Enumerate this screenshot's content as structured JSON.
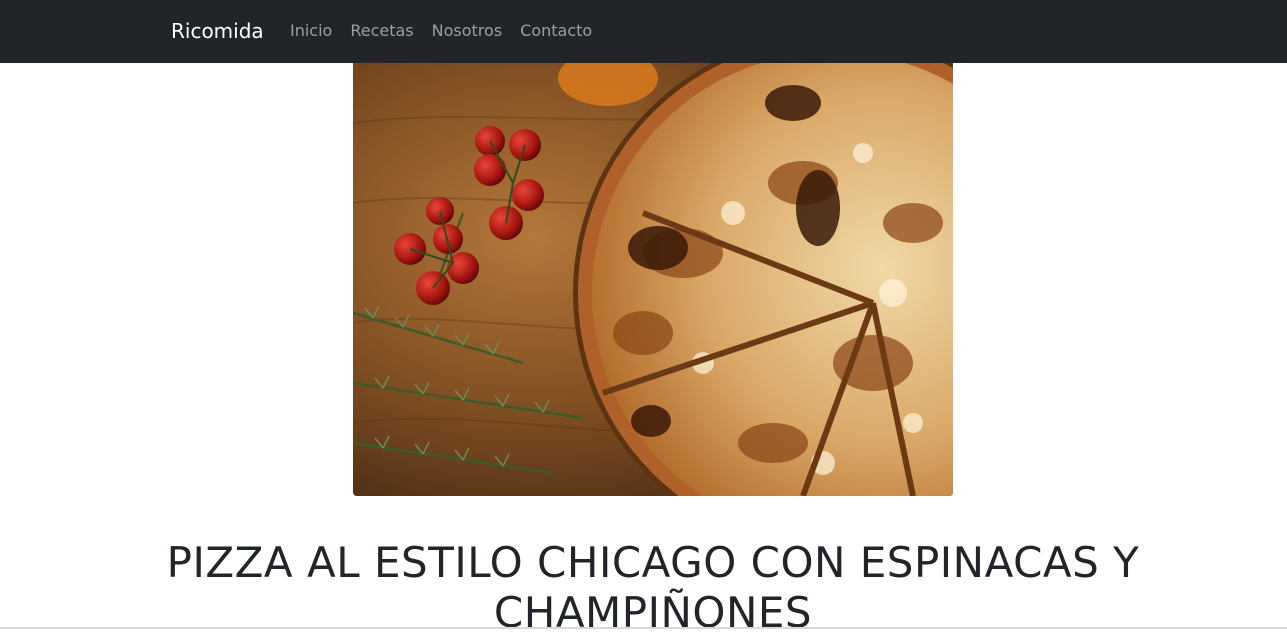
{
  "navbar": {
    "brand": "Ricomida",
    "links": [
      {
        "label": "Inicio"
      },
      {
        "label": "Recetas"
      },
      {
        "label": "Nosotros"
      },
      {
        "label": "Contacto"
      }
    ]
  },
  "recipe": {
    "image_alt": "Pizza",
    "title": "PIZZA AL ESTILO CHICAGO CON ESPINACAS Y CHAMPIÑONES"
  },
  "colors": {
    "navbar_bg": "#212529",
    "brand_text": "#ffffff",
    "nav_link_text": "rgba(255,255,255,0.55)",
    "title_text": "#212529"
  }
}
